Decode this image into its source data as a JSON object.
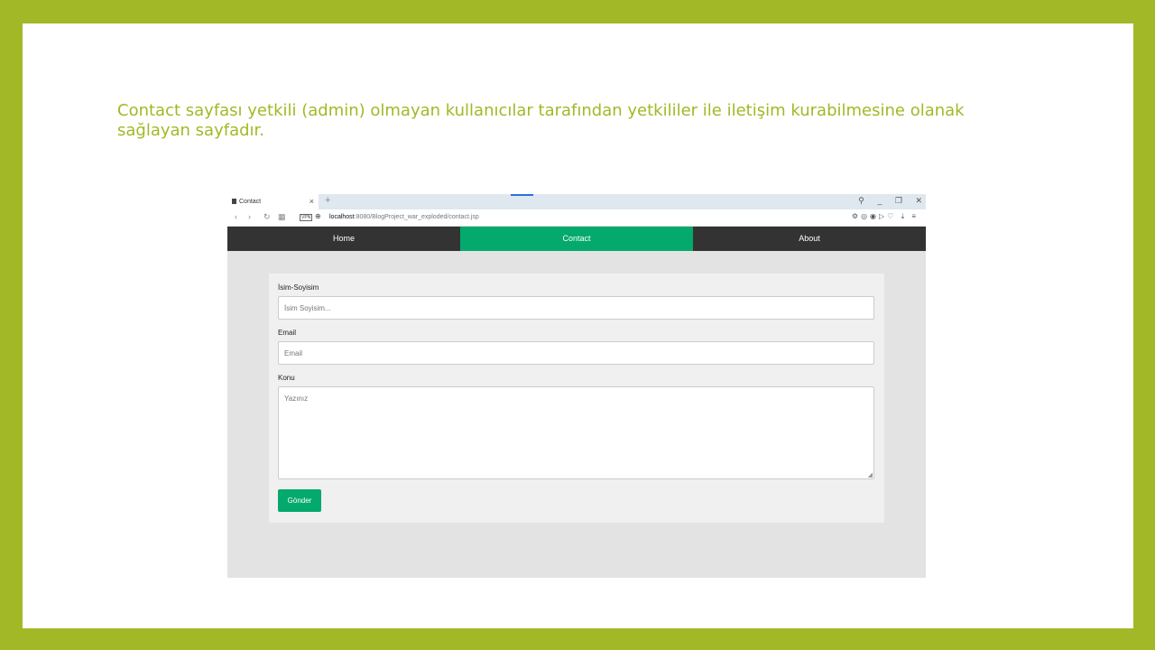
{
  "slide": {
    "text": "Contact sayfası yetkili (admin) olmayan kullanıcılar tarafından yetkililer ile iletişim kurabilmesine olanak sağlayan sayfadır."
  },
  "browser": {
    "tab_title": "Contact",
    "tab_close": "×",
    "new_tab": "+",
    "url_host": "localhost",
    "url_path": ":8080/BlogProject_war_exploded/contact.jsp",
    "vpn_label": "VPN"
  },
  "navbar": {
    "items": [
      {
        "label": "Home",
        "active": false
      },
      {
        "label": "Contact",
        "active": true
      },
      {
        "label": "About",
        "active": false
      }
    ]
  },
  "form": {
    "name_label": "İsim-Soyisim",
    "name_placeholder": "İsim Soyisim...",
    "email_label": "Email",
    "email_placeholder": "Email",
    "subject_label": "Konu",
    "subject_placeholder": "Yazınız",
    "submit_label": "Gönder"
  },
  "colors": {
    "frame": "#a3b826",
    "accent": "#04a96d",
    "navbar_bg": "#333333"
  }
}
